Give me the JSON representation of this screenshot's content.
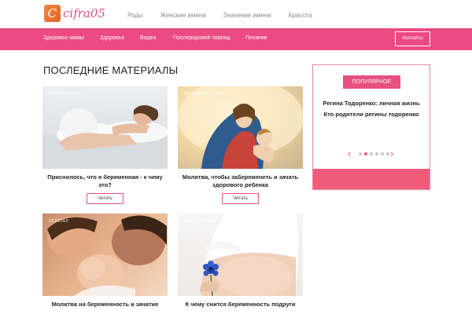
{
  "logo": {
    "letter": "C",
    "text": "cifra05"
  },
  "topnav": [
    "Роды",
    "Женские имена",
    "Значение имени",
    "Красота"
  ],
  "pinknav": [
    "Здоровье мамы",
    "Здоровье",
    "Видео",
    "Послеродовой период",
    "Питание"
  ],
  "contacts": "Контакты",
  "section_title": "ПОСЛЕДНИЕ МАТЕРИАЛЫ",
  "cards": [
    {
      "category": "Что означает",
      "title": "Приснилось, что я беременная - к чему это?",
      "button": "Читать"
    },
    {
      "category": "Значение слова",
      "title": "Молитва, чтобы забеременеть и зачать здорового ребенка",
      "button": "Читать"
    },
    {
      "category": "Сексуал",
      "title": "Молитва на беременность и зачатие"
    },
    {
      "category": "Эффект и восстановление",
      "title": "К чему снится беременность подруги"
    }
  ],
  "popular": {
    "label": "ПОПУЛЯРНОЕ",
    "text_line1": "Регина Тодоренко: личная жизнь",
    "text_line2": "Кто родители регины тодоренко",
    "prev": "‹",
    "next": "›",
    "dots_total": 6,
    "active_dot": 1
  },
  "colors": {
    "brand_pink": "#eb4a82",
    "logo_orange": "#e0602a",
    "logo_text": "#d8508a"
  }
}
